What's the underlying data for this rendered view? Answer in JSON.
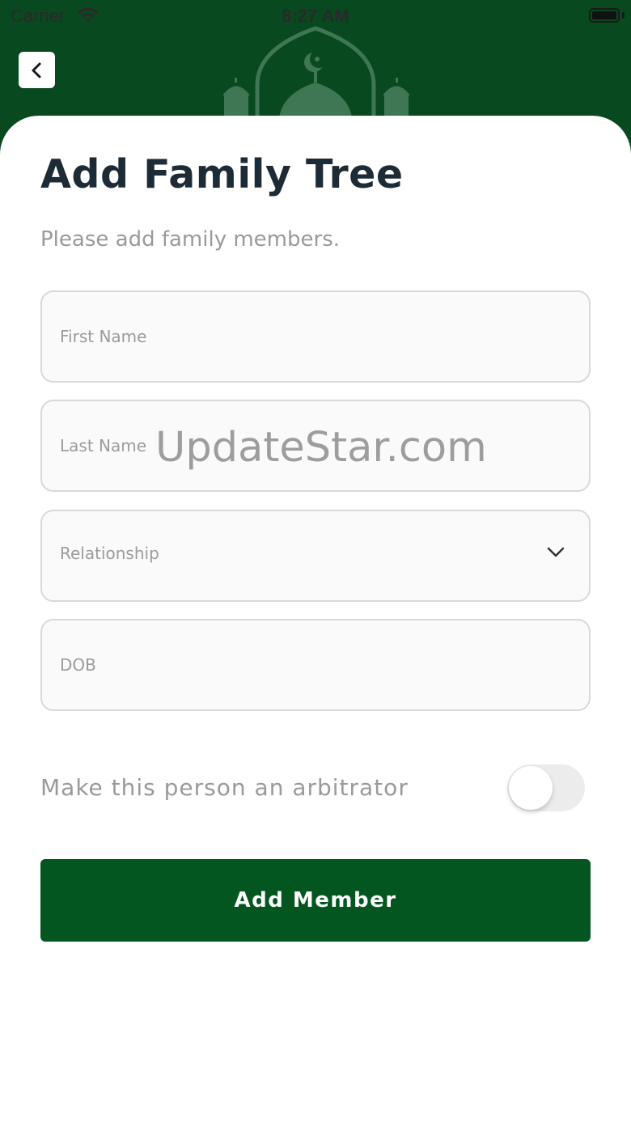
{
  "status_bar": {
    "carrier": "Carrier",
    "time": "8:27 AM"
  },
  "header": {
    "back_icon": "chevron-left-icon",
    "decoration": "mosque-icon"
  },
  "form": {
    "title": "Add Family Tree",
    "subtitle": "Please add family members.",
    "first_name_placeholder": "First Name",
    "last_name_placeholder": "Last Name",
    "relationship_label": "Relationship",
    "dob_placeholder": "DOB",
    "arbitrator_label": "Make this person an arbitrator",
    "arbitrator_enabled": false,
    "submit_label": "Add Member"
  },
  "watermark": "UpdateStar.com",
  "colors": {
    "header_green": "#08491f",
    "button_green": "#03561f",
    "title": "#1d2b36"
  }
}
